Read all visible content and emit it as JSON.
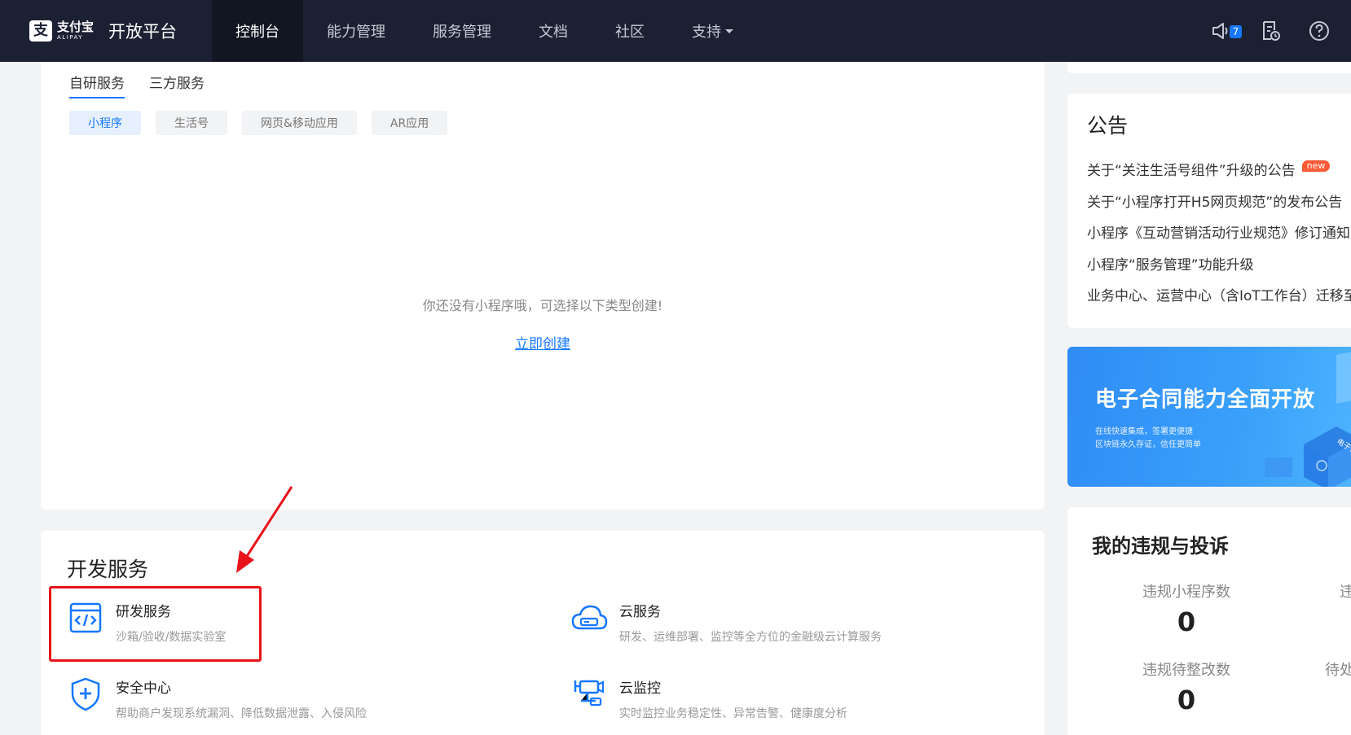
{
  "nav": {
    "logo_mark": "支",
    "logo_cn": "支付宝",
    "logo_en": "ALIPAY",
    "title": "开放平台",
    "items": [
      {
        "label": "控制台"
      },
      {
        "label": "能力管理"
      },
      {
        "label": "服务管理"
      },
      {
        "label": "文档"
      },
      {
        "label": "社区"
      },
      {
        "label": "支持"
      }
    ],
    "notification_count": "7",
    "icons": [
      "speaker-icon",
      "document-clock-icon",
      "help-icon"
    ]
  },
  "main": {
    "tabs": [
      {
        "label": "自研服务"
      },
      {
        "label": "三方服务"
      }
    ],
    "chips": [
      {
        "label": "小程序"
      },
      {
        "label": "生活号"
      },
      {
        "label": "网页&移动应用"
      },
      {
        "label": "AR应用"
      }
    ],
    "empty_text": "你还没有小程序哦，可选择以下类型创建!",
    "create_link": "立即创建"
  },
  "dev": {
    "title": "开发服务",
    "services": [
      {
        "name": "研发服务",
        "desc": "沙箱/验收/数据实验室",
        "icon": "code-window-icon"
      },
      {
        "name": "云服务",
        "desc": "研发、运维部署、监控等全方位的金融级云计算服务",
        "icon": "cloud-icon"
      },
      {
        "name": "安全中心",
        "desc": "帮助商户发现系统漏洞、降低数据泄露、入侵风险",
        "icon": "shield-plus-icon"
      },
      {
        "name": "云监控",
        "desc": "实时监控业务稳定性、异常告警、健康度分析",
        "icon": "monitor-camera-icon"
      }
    ]
  },
  "notice": {
    "title": "公告",
    "new_tag": "new",
    "items": [
      {
        "text": "关于“关注生活号组件”升级的公告"
      },
      {
        "text": "关于“小程序打开H5网页规范”的发布公告"
      },
      {
        "text": "小程序《互动营销活动行业规范》修订通知"
      },
      {
        "text": "小程序“服务管理”功能升级"
      },
      {
        "text": "业务中心、运营中心（含IoT工作台）迁移至"
      }
    ]
  },
  "banner": {
    "title": "电子合同能力全面开放",
    "sub1": "在线快速集成，签署更便捷",
    "sub2": "区块链永久存证，信任更简单",
    "art_label": "电子合同"
  },
  "violation": {
    "title": "我的违规与投诉",
    "stats": [
      {
        "label": "违规小程序数",
        "value": "0"
      },
      {
        "label": "违规待整改数",
        "value": "0"
      },
      {
        "label": "违",
        "value": ""
      },
      {
        "label": "待处",
        "value": ""
      }
    ]
  },
  "colors": {
    "nav_bg": "#1c2033",
    "accent": "#1677ff",
    "highlight_red": "#e8131a",
    "new_tag": "#ff5a36"
  }
}
